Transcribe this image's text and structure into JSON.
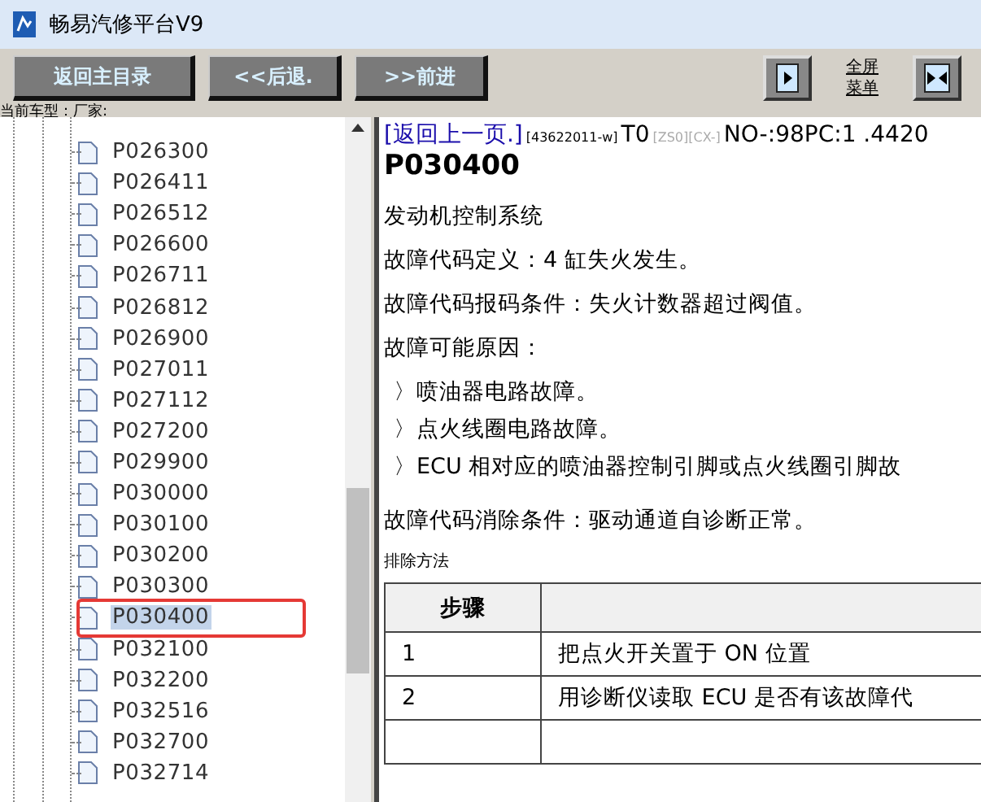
{
  "window": {
    "title": "畅易汽修平台V9"
  },
  "toolbar": {
    "buttons": [
      "返回主目录",
      "<<后退.",
      ">>前进"
    ],
    "fullscreen_label": "全屏菜单"
  },
  "vehicle_label": "当前车型：厂家:",
  "tree": {
    "items": [
      {
        "label": "P026300",
        "selected": false
      },
      {
        "label": "P026411",
        "selected": false
      },
      {
        "label": "P026512",
        "selected": false
      },
      {
        "label": "P026600",
        "selected": false
      },
      {
        "label": "P026711",
        "selected": false
      },
      {
        "label": "P026812",
        "selected": false
      },
      {
        "label": "P026900",
        "selected": false
      },
      {
        "label": "P027011",
        "selected": false
      },
      {
        "label": "P027112",
        "selected": false
      },
      {
        "label": "P027200",
        "selected": false
      },
      {
        "label": "P029900",
        "selected": false
      },
      {
        "label": "P030000",
        "selected": false
      },
      {
        "label": "P030100",
        "selected": false
      },
      {
        "label": "P030200",
        "selected": false
      },
      {
        "label": "P030300",
        "selected": false
      },
      {
        "label": "P030400",
        "selected": true
      },
      {
        "label": "P032100",
        "selected": false
      },
      {
        "label": "P032200",
        "selected": false
      },
      {
        "label": "P032516",
        "selected": false
      },
      {
        "label": "P032700",
        "selected": false
      },
      {
        "label": "P032714",
        "selected": false
      }
    ]
  },
  "content": {
    "back_link": "[返回上一页.]",
    "doc_id": "[43622011-w]",
    "t_code": "T0",
    "tags": "[ZS0][CX-]",
    "number": "NO-:98PC:1 .4420",
    "code": "P030400",
    "system": "发动机控制系统",
    "definition": "故障代码定义：4 缸失火发生。",
    "condition": "故障代码报码条件：失火计数器超过阀值。",
    "causes_title": "故障可能原因：",
    "causes": [
      "〉喷油器电路故障。",
      "〉点火线圈电路故障。",
      "〉ECU 相对应的喷油器控制引脚或点火线圈引脚故"
    ],
    "clear_condition": "故障代码消除条件：驱动通道自诊断正常。",
    "method_title": "排除方法",
    "table": {
      "columns": [
        "步骤"
      ],
      "rows": [
        [
          "1",
          "把点火开关置于 ON 位置"
        ],
        [
          "2",
          "用诊断仪读取 ECU 是否有该故障代"
        ]
      ]
    }
  }
}
